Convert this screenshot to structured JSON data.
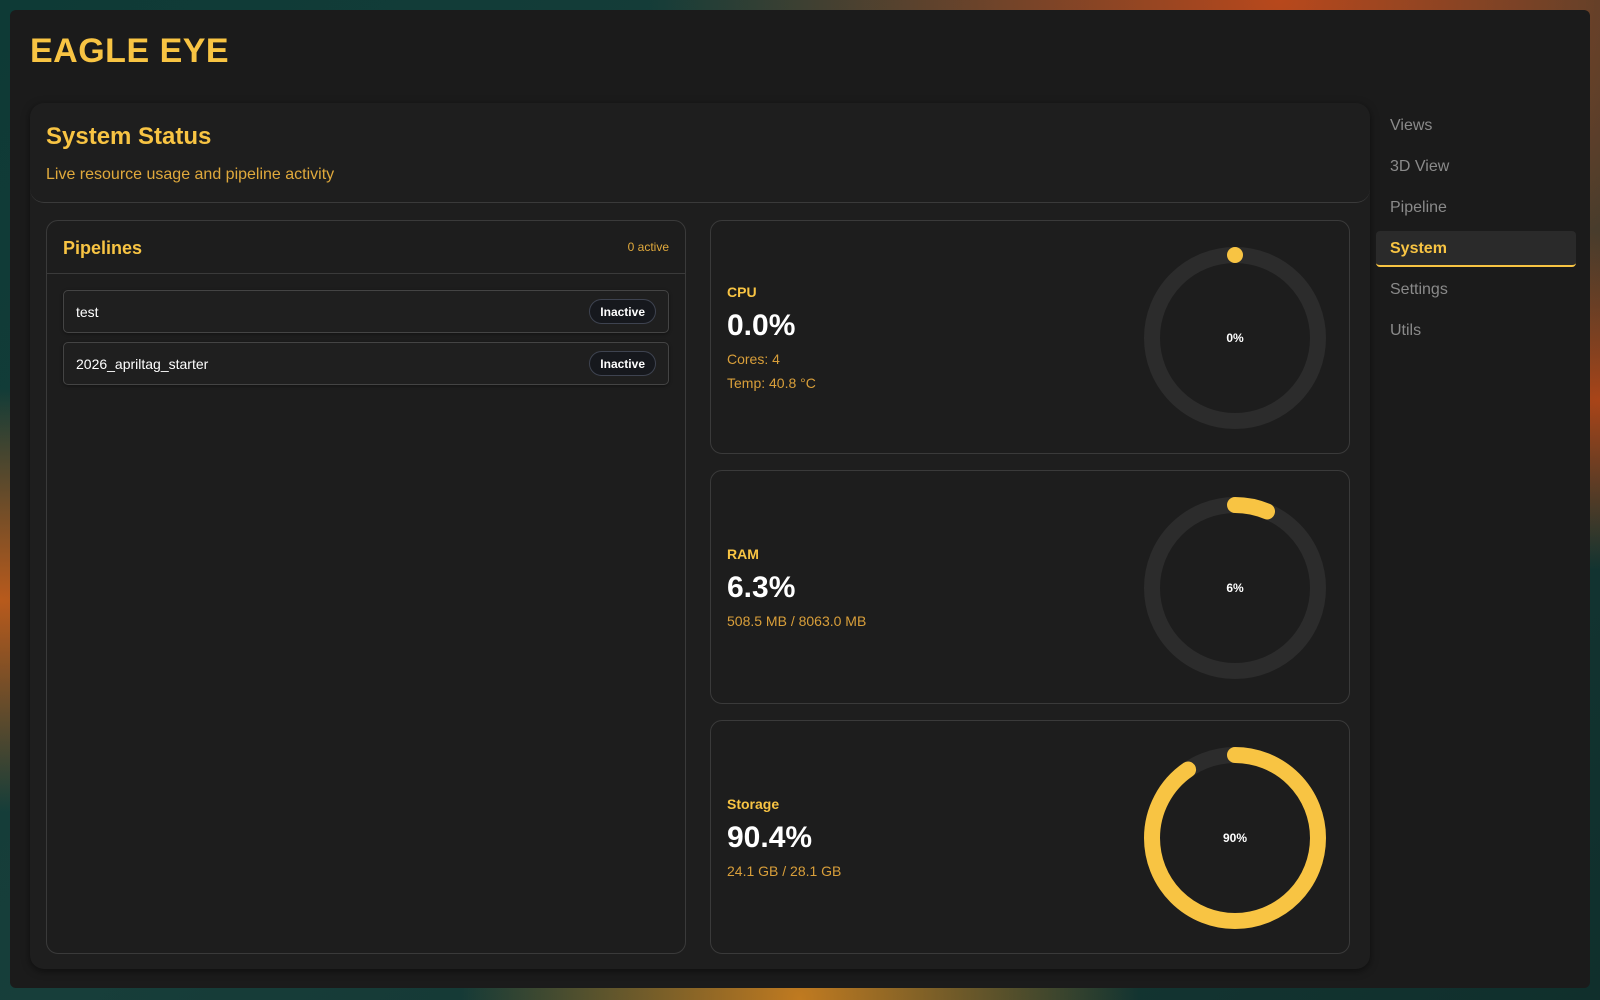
{
  "app": {
    "title": "EAGLE EYE"
  },
  "header": {
    "title": "System Status",
    "subtitle": "Live resource usage and pipeline activity"
  },
  "pipelines": {
    "title": "Pipelines",
    "count_label": "0 active",
    "items": [
      {
        "name": "test",
        "status": "Inactive"
      },
      {
        "name": "2026_apriltag_starter",
        "status": "Inactive"
      }
    ]
  },
  "metrics": {
    "cpu": {
      "label": "CPU",
      "value": "0.0%",
      "details": [
        "Cores: 4",
        "Temp: 40.8 °C"
      ],
      "gauge_label": "0%",
      "fraction": 0.0
    },
    "ram": {
      "label": "RAM",
      "value": "6.3%",
      "details": [
        "508.5 MB / 8063.0 MB"
      ],
      "gauge_label": "6%",
      "fraction": 0.063
    },
    "storage": {
      "label": "Storage",
      "value": "90.4%",
      "details": [
        "24.1 GB / 28.1 GB"
      ],
      "gauge_label": "90%",
      "fraction": 0.904
    }
  },
  "sidebar": {
    "items": [
      {
        "label": "Views"
      },
      {
        "label": "3D View"
      },
      {
        "label": "Pipeline"
      },
      {
        "label": "System",
        "active": true
      },
      {
        "label": "Settings"
      },
      {
        "label": "Utils"
      }
    ]
  },
  "colors": {
    "accent": "#f8c443",
    "track": "#2c2c2c",
    "panel": "#1d1d1d"
  }
}
